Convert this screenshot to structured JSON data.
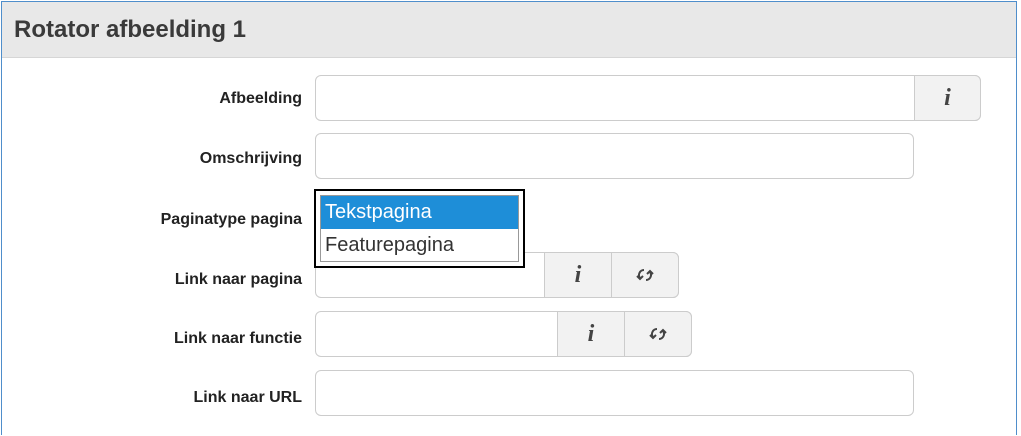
{
  "panel": {
    "title": "Rotator afbeelding 1"
  },
  "fields": {
    "afbeelding": {
      "label": "Afbeelding",
      "value": ""
    },
    "omschrijving": {
      "label": "Omschrijving",
      "value": ""
    },
    "paginatype": {
      "label": "Paginatype pagina"
    },
    "link_pagina": {
      "label": "Link naar pagina",
      "value": ""
    },
    "link_functie": {
      "label": "Link naar functie",
      "value": ""
    },
    "link_url": {
      "label": "Link naar URL",
      "value": ""
    }
  },
  "dropdown": {
    "options": [
      "Tekstpagina",
      "Featurepagina"
    ],
    "selected": "Tekstpagina"
  },
  "icons": {
    "info": "info-icon",
    "refresh": "refresh-icon",
    "info_glyph": "i"
  },
  "colors": {
    "header_bg": "#e8e8e8",
    "panel_border": "#4f8ecb",
    "selected_option": "#1e8ed8"
  }
}
